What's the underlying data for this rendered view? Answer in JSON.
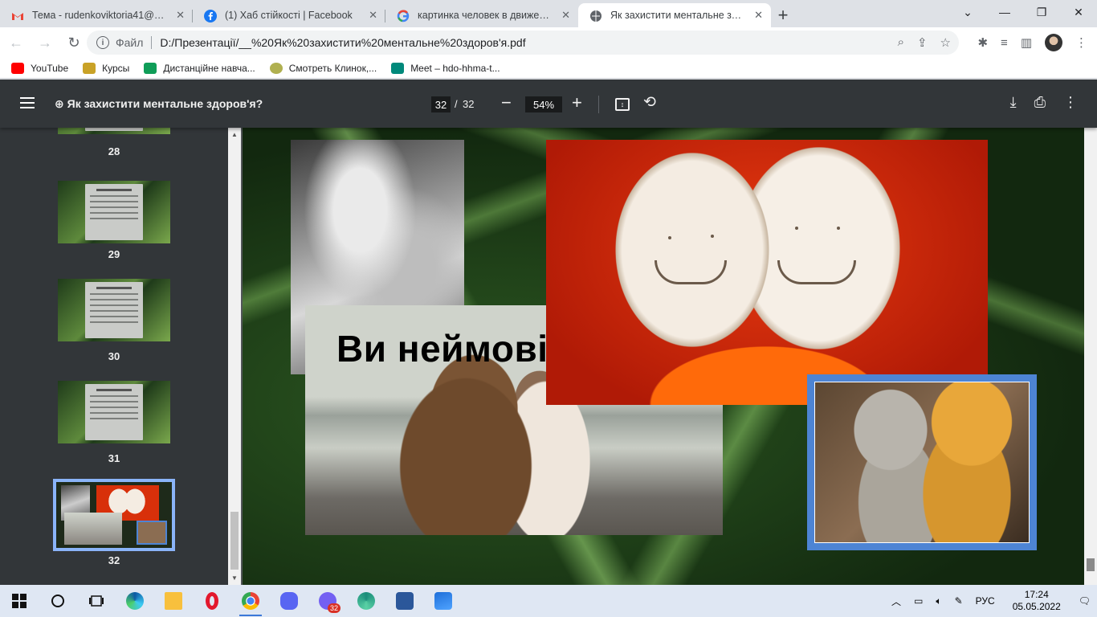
{
  "tabs": [
    {
      "title": "Тема - rudenkoviktoria41@gmail...",
      "icon": "gmail-icon",
      "color": "#ea4335"
    },
    {
      "title": "(1) Хаб стійкості | Facebook",
      "icon": "facebook-icon",
      "color": "#1877f2"
    },
    {
      "title": "картинка человек в движении -",
      "icon": "google-icon",
      "color": "#4285f4"
    },
    {
      "title": "Як захистити ментальне здор...",
      "icon": "globe-icon",
      "color": "#5f6368",
      "active": true
    }
  ],
  "address": {
    "scheme": "Файл",
    "url": "D:/Презентації/__%20Як%20захистити%20ментальне%20здоров'я.pdf"
  },
  "bookmarks": [
    {
      "label": "YouTube",
      "color": "#ff0000"
    },
    {
      "label": "Курсы",
      "color": "#c9a227"
    },
    {
      "label": "Дистанційне навча...",
      "color": "#0f9d58"
    },
    {
      "label": "Смотреть Клинок,...",
      "color": "#b0b050"
    },
    {
      "label": "Meet – hdo-hhma-t...",
      "color": "#00897b"
    }
  ],
  "pdf": {
    "title": "Як захистити ментальне здоров'я?",
    "current_page": "32",
    "page_sep": "/",
    "total_pages": "32",
    "zoom": "54%"
  },
  "thumbnails": [
    {
      "label": "28"
    },
    {
      "label": "29"
    },
    {
      "label": "30"
    },
    {
      "label": "31"
    },
    {
      "label": "32"
    }
  ],
  "slide": {
    "headline": "Ви неймовірні!!!"
  },
  "taskbar": {
    "apps": [
      "windows-start-icon",
      "search-circle-icon",
      "task-view-icon",
      "edge-icon",
      "file-explorer-icon",
      "opera-icon",
      "chrome-icon",
      "discord-icon",
      "viber-icon",
      "edge-canary-icon",
      "word-icon",
      "photos-icon"
    ],
    "viber_badge": "32",
    "language": "РУС",
    "time": "17:24",
    "date": "05.05.2022"
  }
}
